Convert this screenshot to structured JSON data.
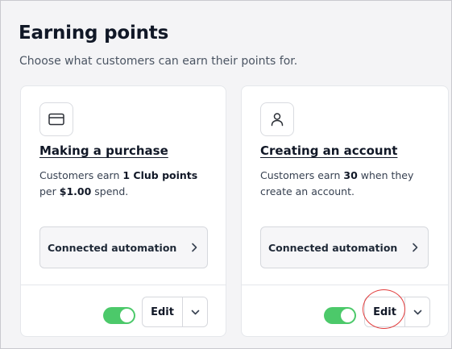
{
  "page": {
    "title": "Earning points",
    "subtitle": "Choose what customers can earn their points for."
  },
  "cards": [
    {
      "icon": "credit-card-icon",
      "title": "Making a purchase",
      "desc_prefix": "Customers earn ",
      "desc_bold1": "1 Club points",
      "desc_mid": " per ",
      "desc_bold2": "$1.00",
      "desc_suffix": " spend.",
      "automation_label": "Connected automation",
      "toggle_on": true,
      "edit_label": "Edit"
    },
    {
      "icon": "user-icon",
      "title": "Creating an account",
      "desc_prefix": "Customers earn ",
      "desc_bold1": "30",
      "desc_suffix": " when they create an account.",
      "automation_label": "Connected automation",
      "toggle_on": true,
      "edit_label": "Edit"
    }
  ],
  "colors": {
    "toggle_on": "#4cc96a",
    "highlight": "#e23b3b"
  }
}
